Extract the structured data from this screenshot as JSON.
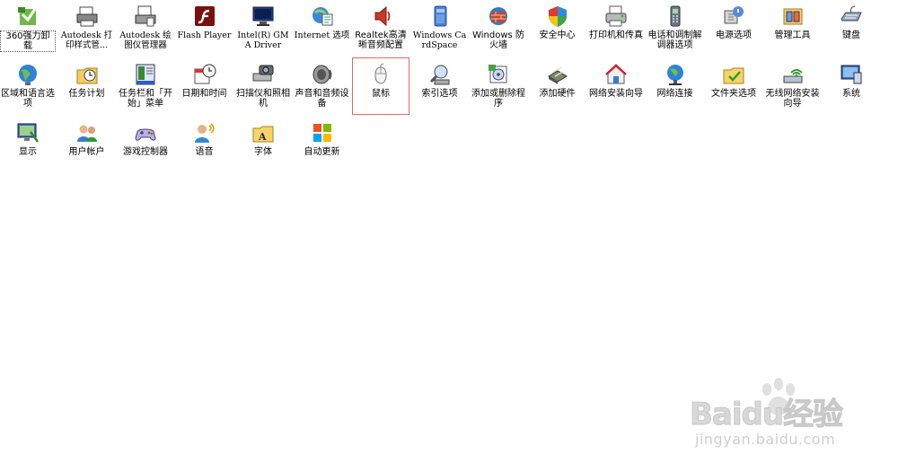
{
  "items": [
    {
      "label": "360强力卸载",
      "icon": "uninstaller-icon"
    },
    {
      "label": "Autodesk 打印样式管...",
      "icon": "printer-style-icon",
      "mono": true
    },
    {
      "label": "Autodesk 绘图仪管理器",
      "icon": "plotter-manager-icon",
      "mono": true
    },
    {
      "label": "Flash Player",
      "icon": "flash-icon",
      "mono": true
    },
    {
      "label": "Intel(R) GMA Driver",
      "icon": "intel-monitor-icon",
      "mono": true
    },
    {
      "label": "Internet 选项",
      "icon": "internet-options-icon",
      "mono": true
    },
    {
      "label": "Realtek高清晰音频配置",
      "icon": "speaker-audio-icon"
    },
    {
      "label": "Windows CardSpace",
      "icon": "cardspace-icon",
      "mono": true
    },
    {
      "label": "Windows 防火墙",
      "icon": "firewall-icon"
    },
    {
      "label": "安全中心",
      "icon": "security-shield-icon"
    },
    {
      "label": "打印机和传真",
      "icon": "printer-fax-icon"
    },
    {
      "label": "电话和调制解调器选项",
      "icon": "phone-modem-icon"
    },
    {
      "label": "电源选项",
      "icon": "power-options-icon"
    },
    {
      "label": "管理工具",
      "icon": "admin-tools-icon"
    },
    {
      "label": "键盘",
      "icon": "keyboard-icon"
    },
    {
      "label": "区域和语言选项",
      "icon": "globe-region-icon"
    },
    {
      "label": "任务计划",
      "icon": "scheduled-tasks-icon"
    },
    {
      "label": "任务栏和「开始」菜单",
      "icon": "taskbar-start-icon"
    },
    {
      "label": "日期和时间",
      "icon": "date-time-icon"
    },
    {
      "label": "扫描仪和照相机",
      "icon": "scanner-camera-icon"
    },
    {
      "label": "声音和音频设备",
      "icon": "sound-devices-icon"
    },
    {
      "label": "鼠标",
      "icon": "mouse-icon",
      "selected": true
    },
    {
      "label": "索引选项",
      "icon": "indexing-icon"
    },
    {
      "label": "添加或删除程序",
      "icon": "add-remove-programs-icon"
    },
    {
      "label": "添加硬件",
      "icon": "add-hardware-icon"
    },
    {
      "label": "网络安装向导",
      "icon": "network-setup-icon"
    },
    {
      "label": "网络连接",
      "icon": "network-connections-icon"
    },
    {
      "label": "文件夹选项",
      "icon": "folder-options-icon"
    },
    {
      "label": "无线网络安装向导",
      "icon": "wireless-setup-icon"
    },
    {
      "label": "系统",
      "icon": "system-icon"
    },
    {
      "label": "显示",
      "icon": "display-icon"
    },
    {
      "label": "用户帐户",
      "icon": "user-accounts-icon"
    },
    {
      "label": "游戏控制器",
      "icon": "game-controller-icon"
    },
    {
      "label": "语音",
      "icon": "speech-icon"
    },
    {
      "label": "字体",
      "icon": "fonts-folder-icon"
    },
    {
      "label": "自动更新",
      "icon": "auto-update-icon"
    }
  ],
  "watermark": {
    "brand": "Baidu经验",
    "site": "jingyan.baidu.com"
  },
  "colors": {
    "selection_outline": "#e06a6a",
    "watermark": "#d0d0d0"
  }
}
